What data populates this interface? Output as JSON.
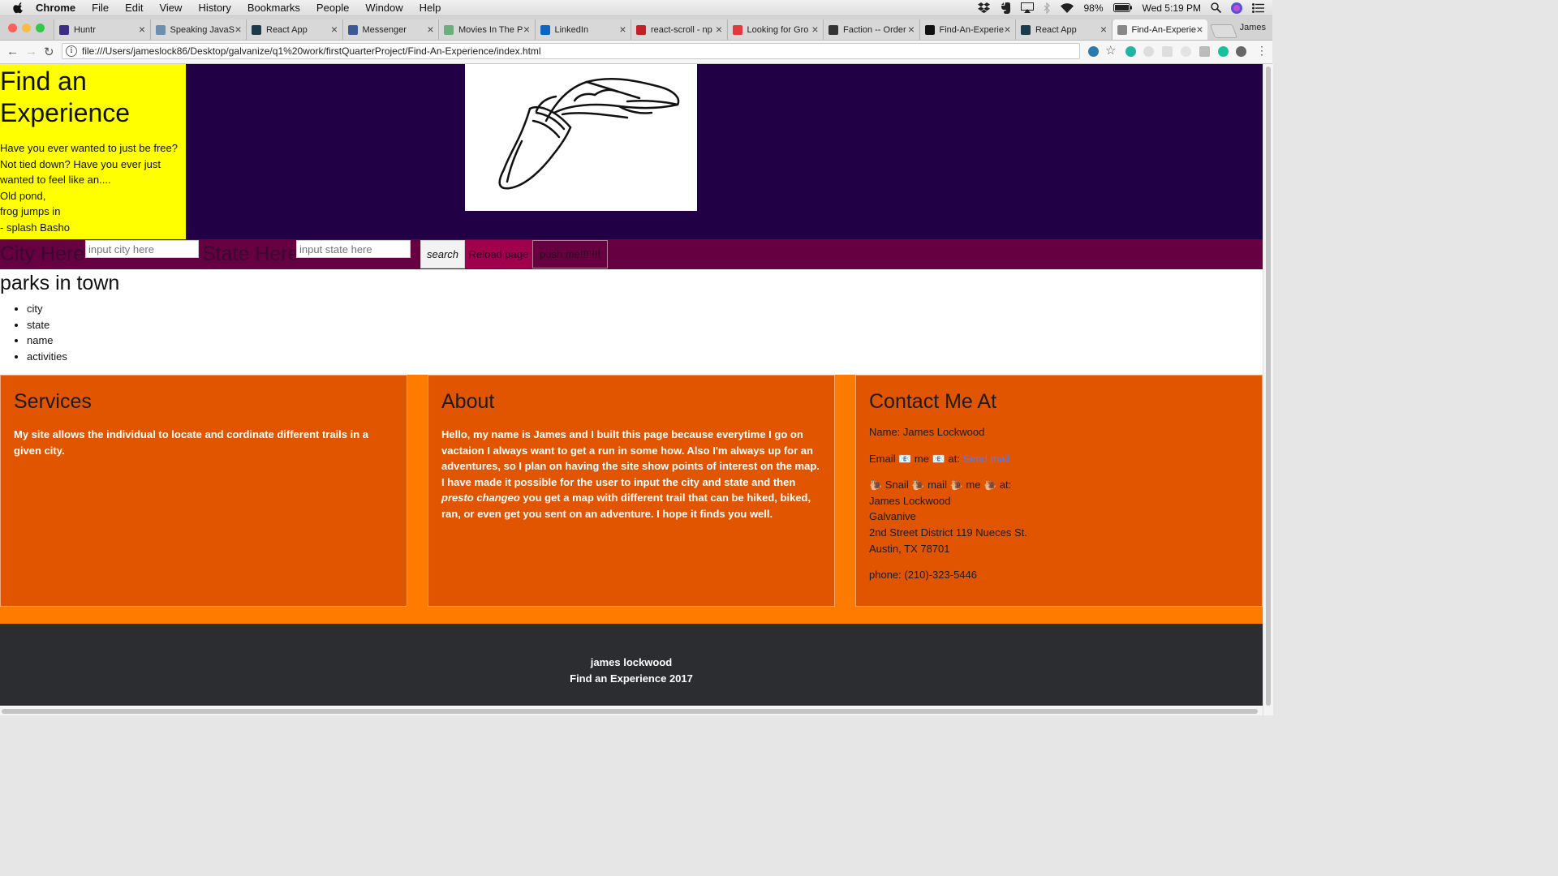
{
  "menubar": {
    "app": "Chrome",
    "items": [
      "File",
      "Edit",
      "View",
      "History",
      "Bookmarks",
      "People",
      "Window",
      "Help"
    ],
    "battery": "98%",
    "clock": "Wed 5:19 PM"
  },
  "tabs": [
    {
      "title": "Huntr",
      "icon": "huntr-icon",
      "color": "#3b2c86"
    },
    {
      "title": "Speaking JavaS",
      "icon": "book-icon",
      "color": "#6b8fb0"
    },
    {
      "title": "React App",
      "icon": "react-icon",
      "color": "#1d3a4a"
    },
    {
      "title": "Messenger",
      "icon": "facebook-icon",
      "color": "#3b5998"
    },
    {
      "title": "Movies In The P",
      "icon": "globe-icon",
      "color": "#6bb07a"
    },
    {
      "title": "LinkedIn",
      "icon": "linkedin-icon",
      "color": "#0a66c2"
    },
    {
      "title": "react-scroll - np",
      "icon": "npm-icon",
      "color": "#c12127"
    },
    {
      "title": "Looking for Gro",
      "icon": "meetup-icon",
      "color": "#e0393e"
    },
    {
      "title": "Faction -- Order",
      "icon": "faction-icon",
      "color": "#333333"
    },
    {
      "title": "Find-An-Experie",
      "icon": "github-icon",
      "color": "#111111"
    },
    {
      "title": "React App",
      "icon": "react-icon",
      "color": "#1d3a4a"
    },
    {
      "title": "Find-An-Experie",
      "icon": "page-icon",
      "color": "#888888",
      "active": true
    }
  ],
  "profile_name": "James",
  "address": "file:///Users/jameslock86/Desktop/galvanize/q1%20work/firstQuarterProject/Find-An-Experience/index.html",
  "hero": {
    "title": "Find an Experience",
    "lines": [
      "Have you ever wanted to just be free?",
      "Not tied down? Have you ever just",
      "wanted to feel like an....",
      "Old pond,",
      "frog jumps in",
      "- splash Basho"
    ]
  },
  "search": {
    "city_label": "City Here",
    "city_placeholder": "input city here",
    "state_label": "State Here",
    "state_placeholder": "input state here",
    "search_button": "search",
    "reload_button": "Reload page",
    "push_button": "push me!!!!!!!"
  },
  "parks": {
    "heading": "parks in town",
    "items": [
      "city",
      "state",
      "name",
      "activities"
    ]
  },
  "services": {
    "heading": "Services",
    "body": "My site allows the individual to locate and cordinate different trails in a given city."
  },
  "about": {
    "heading": "About",
    "body_before": "Hello, my name is James and I built this page because everytime I go on vactaion I always want to get a run in some how. Also I'm always up for an adventures, so I plan on having the site show points of interest on the map. I have made it possible for the user to input the city and state and then ",
    "emphasis": "presto changeo",
    "body_after": " you get a map with different trail that can be hiked, biked, ran, or even get you sent on an adventure. I hope it finds you well."
  },
  "contact": {
    "heading": "Contact Me At",
    "name": "Name: James Lockwood",
    "email_prefix": "Email 📧 me 📧 at:",
    "email_link": "Send mail",
    "snail": "🐌 Snail 🐌 mail 🐌 me 🐌 at:",
    "address_lines": [
      "James Lockwood",
      "Galvanive",
      "2nd Street District 119 Nueces St.",
      "Austin, TX 78701"
    ],
    "phone": "phone: (210)-323-5446"
  },
  "footer": {
    "line1": "james lockwood",
    "line2": "Find an Experience 2017"
  },
  "colors": {
    "hero_bg": "#210045",
    "hero_text_bg": "#ffff00",
    "search_bg": "#660040",
    "reload_bg": "#a0004e",
    "cards_bg": "#ff7b00",
    "card_bg": "#e15400",
    "footer_bg": "#2b2d31"
  }
}
